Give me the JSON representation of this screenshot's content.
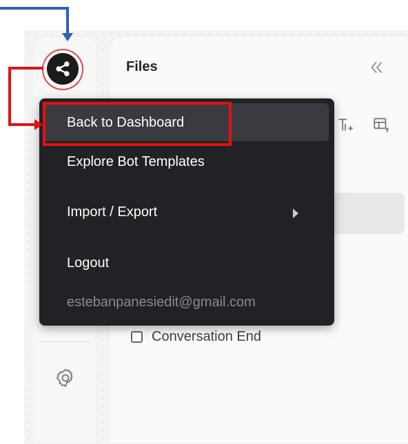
{
  "sidebar": {
    "share_icon": "share-icon",
    "settings_icon": "gear-icon"
  },
  "panel": {
    "title": "Files",
    "collapse_icon": "double-chevron-left-icon",
    "tool_icons": [
      "add-text-icon",
      "add-table-icon"
    ],
    "checklist_item": "Conversation End"
  },
  "menu": {
    "items": [
      {
        "label": "Back to Dashboard",
        "active": true
      },
      {
        "label": "Explore Bot Templates"
      },
      {
        "label": "Import / Export",
        "has_submenu": true
      },
      {
        "label": "Logout"
      }
    ],
    "email": "estebanpanesiedit@gmail.com"
  },
  "colors": {
    "menu_bg": "#212226",
    "annotation_red": "#e31010",
    "annotation_blue": "#2b5fbd"
  }
}
